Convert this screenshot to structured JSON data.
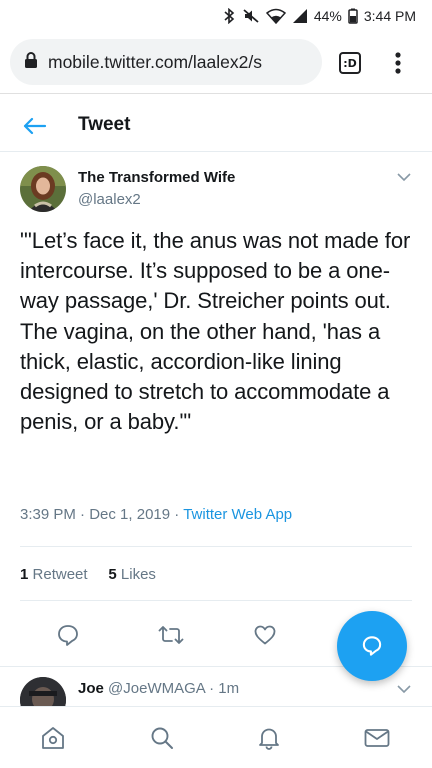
{
  "status_bar": {
    "battery": "44%",
    "time": "3:44 PM"
  },
  "browser": {
    "url": "mobile.twitter.com/laalex2/s",
    "tabs_label": ":D"
  },
  "header": {
    "title": "Tweet"
  },
  "tweet": {
    "author_name": "The Transformed Wife",
    "author_handle": "@laalex2",
    "text": "\"'Let’s face it, the anus was not made for intercourse. It’s supposed to be a one-way passage,' Dr. Streicher points out. The vagina, on the other hand, 'has a thick, elastic, accordion-like lining designed to stretch to accommodate a penis, or a baby.'\"",
    "time": "3:39 PM",
    "date": "Dec 1, 2019",
    "separator": "·",
    "source": "Twitter Web App",
    "retweet_count": "1",
    "retweet_label": "Retweet",
    "like_count": "5",
    "like_label": "Likes"
  },
  "reply": {
    "name": "Joe",
    "handle": "@JoeWMAGA",
    "separator": "·",
    "time": "1m"
  },
  "colors": {
    "accent": "#1da1f2",
    "secondary_text": "#657786",
    "link": "#1b95e0"
  },
  "icons": {
    "status": [
      "bluetooth-icon",
      "mute-icon",
      "wifi-icon",
      "signal-icon",
      "battery-icon"
    ],
    "actions": [
      "reply-icon",
      "retweet-icon",
      "like-icon"
    ],
    "nav": [
      "home-icon",
      "search-icon",
      "notifications-icon",
      "messages-icon"
    ]
  }
}
